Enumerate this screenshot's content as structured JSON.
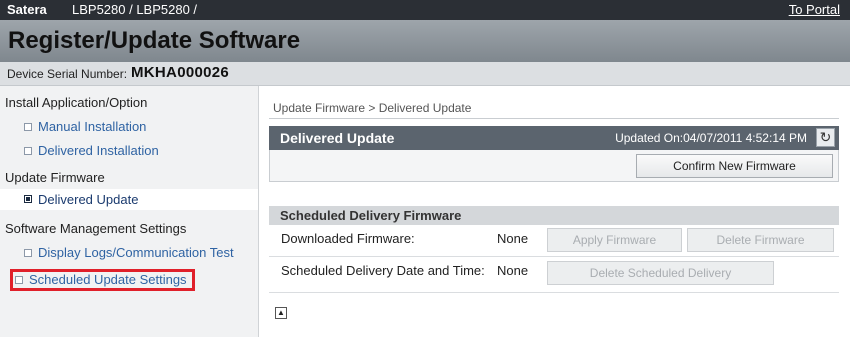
{
  "topbar": {
    "brand": "Satera",
    "model": "LBP5280 / LBP5280 /",
    "portal_link": "To Portal"
  },
  "page_title": "Register/Update Software",
  "serial": {
    "label": "Device Serial Number:",
    "value": "MKHA000026"
  },
  "sidebar": {
    "section1": "Install Application/Option",
    "item_manual": "Manual Installation",
    "item_delivered_install": "Delivered Installation",
    "section2": "Update Firmware",
    "item_delivered_update": "Delivered Update",
    "section3": "Software Management Settings",
    "item_logs": "Display Logs/Communication Test",
    "item_scheduled": "Scheduled Update Settings"
  },
  "main": {
    "breadcrumb": "Update Firmware > Delivered Update",
    "panel_title": "Delivered Update",
    "updated_on": "Updated On:04/07/2011 4:52:14 PM",
    "confirm_button": "Confirm New Firmware",
    "section_title": "Scheduled Delivery Firmware",
    "row1_label": "Downloaded Firmware:",
    "row1_value": "None",
    "apply_button": "Apply Firmware",
    "delete_button": "Delete Firmware",
    "row2_label": "Scheduled Delivery Date and Time:",
    "row2_value": "None",
    "delete_scheduled_button": "Delete Scheduled Delivery"
  },
  "icons": {
    "refresh": "refresh-icon",
    "to_top": "to-top-icon",
    "bullet": "square-bullet-icon"
  },
  "colors": {
    "highlight": "#e0202a",
    "link": "#2f63a3",
    "header": "#5b646e"
  }
}
